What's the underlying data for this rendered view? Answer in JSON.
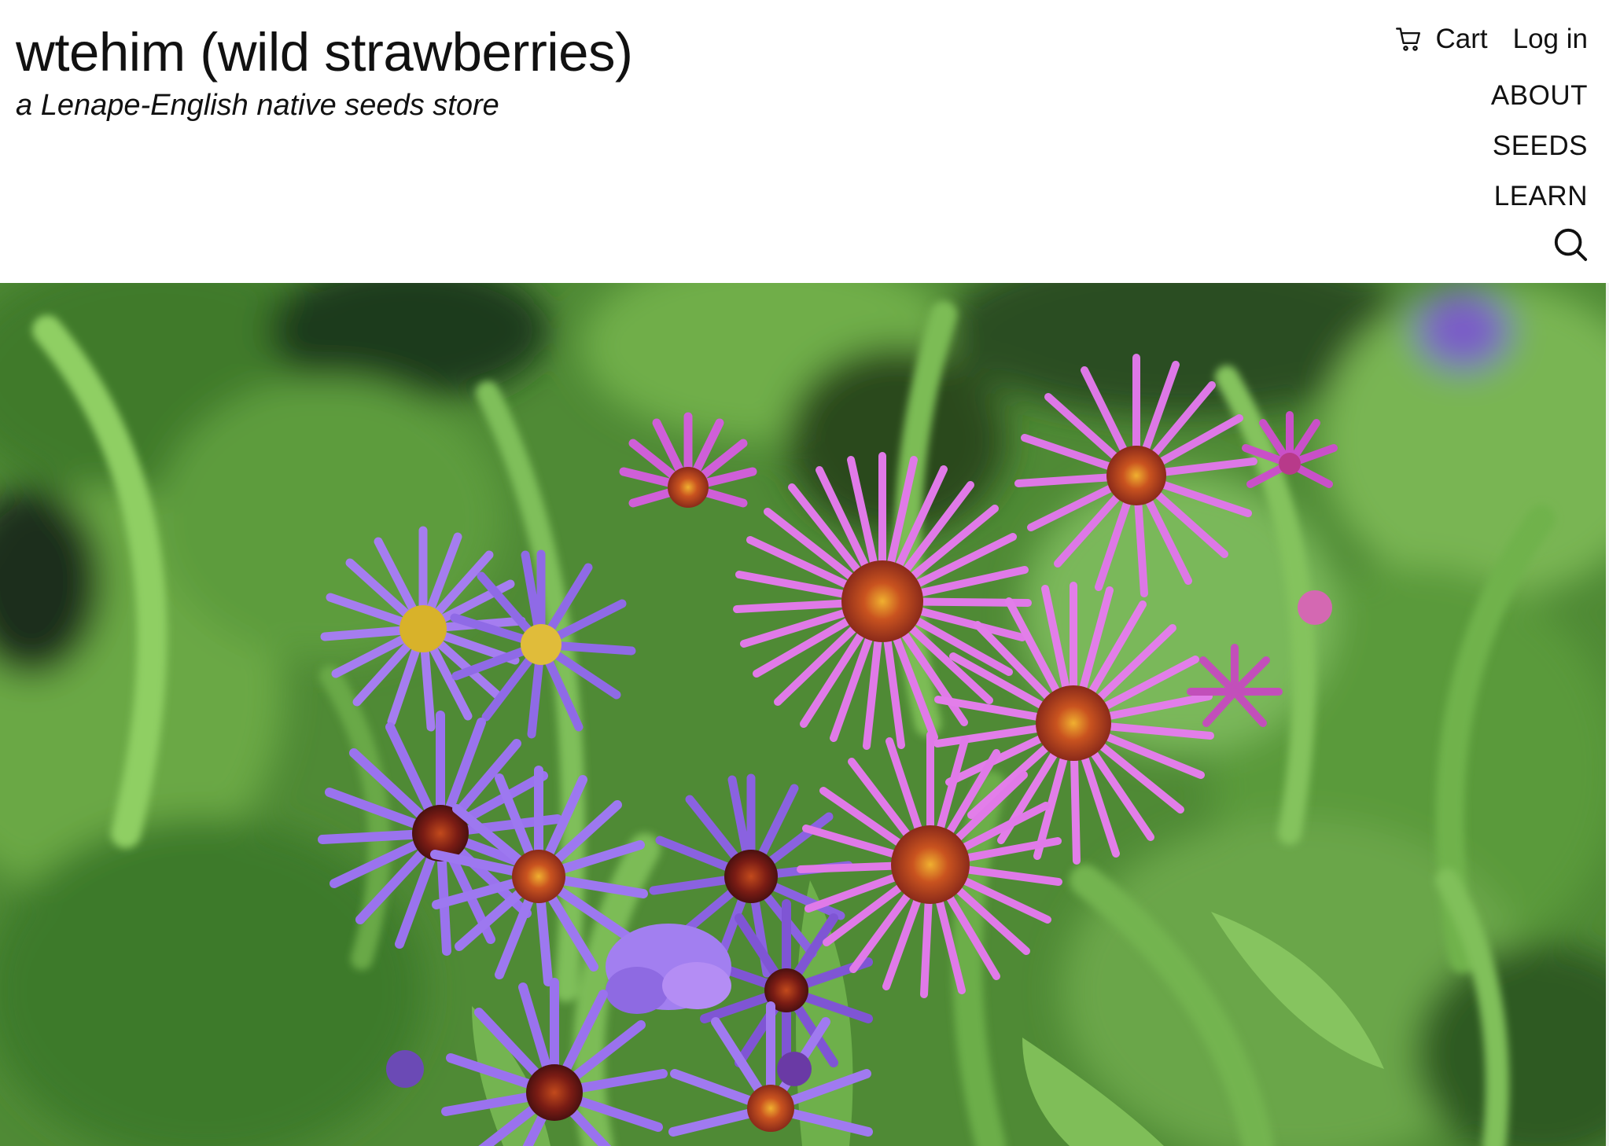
{
  "header": {
    "title": "wtehim (wild strawberries)",
    "tagline": "a Lenape-English native seeds store",
    "cart_label": "Cart",
    "cart_icon": "cart-icon",
    "login_label": "Log in",
    "search_icon": "search-icon"
  },
  "nav": {
    "items": [
      {
        "label": "ABOUT"
      },
      {
        "label": "SEEDS"
      },
      {
        "label": "LEARN"
      }
    ]
  },
  "hero": {
    "subject": "purple and pink aster flowers",
    "colors": {
      "leaf": "#5f9e3f",
      "pink_petal": "#d56ee0",
      "violet_petal": "#9866e6",
      "center": "#b8421d"
    }
  }
}
